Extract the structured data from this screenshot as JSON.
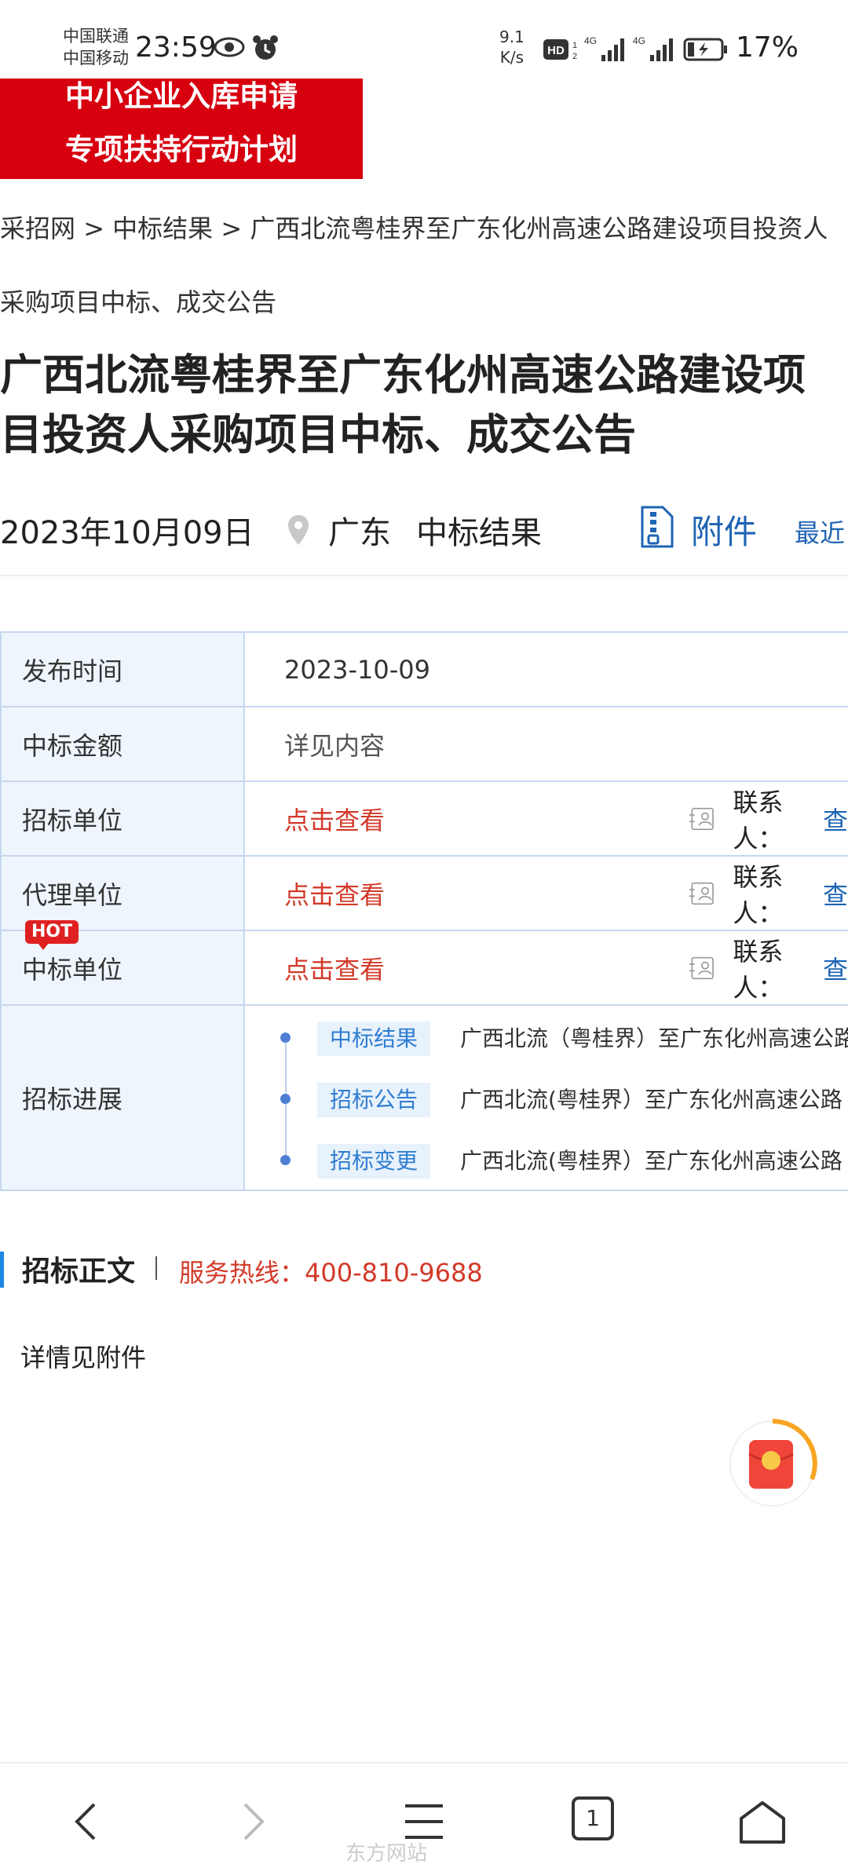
{
  "status_bar": {
    "carrier1": "中国联通",
    "carrier2": "中国移动",
    "time": "23:59",
    "speed_value": "9.1",
    "speed_unit": "K/s",
    "battery": "17%"
  },
  "promo": {
    "line1": "中小企业入库申请",
    "line2": "专项扶持行动计划"
  },
  "breadcrumb": {
    "site": "采招网",
    "sep1": " > ",
    "section": "中标结果",
    "sep2": " > ",
    "current": "广西北流粤桂界至广东化州高速公路建设项目投资人采购项目中标、成交公告"
  },
  "title": "广西北流粤桂界至广东化州高速公路建设项目投资人采购项目中标、成交公告",
  "meta": {
    "date": "2023年10月09日",
    "region": "广东",
    "category": "中标结果",
    "attachment": "附件",
    "recent": "最近"
  },
  "info": {
    "publish_time_label": "发布时间",
    "publish_time": "2023-10-09",
    "amount_label": "中标金额",
    "amount": "详见内容",
    "tenderer_label": "招标单位",
    "tenderer": "点击查看",
    "agent_label": "代理单位",
    "agent": "点击查看",
    "winner_label": "中标单位",
    "winner": "点击查看",
    "contact_label": "联系人：",
    "contact_link": "查",
    "hot": "HOT",
    "progress_label": "招标进展",
    "progress": [
      {
        "tag": "中标结果",
        "text": "广西北流（粤桂界）至广东化州高速公路"
      },
      {
        "tag": "招标公告",
        "text": "广西北流(粤桂界）至广东化州高速公路"
      },
      {
        "tag": "招标变更",
        "text": "广西北流(粤桂界）至广东化州高速公路"
      }
    ]
  },
  "section": {
    "title": "招标正文",
    "hotline": "服务热线：400-810-9688"
  },
  "content": "详情见附件",
  "nav": {
    "tabs_count": "1"
  },
  "watermark": "东方网站"
}
